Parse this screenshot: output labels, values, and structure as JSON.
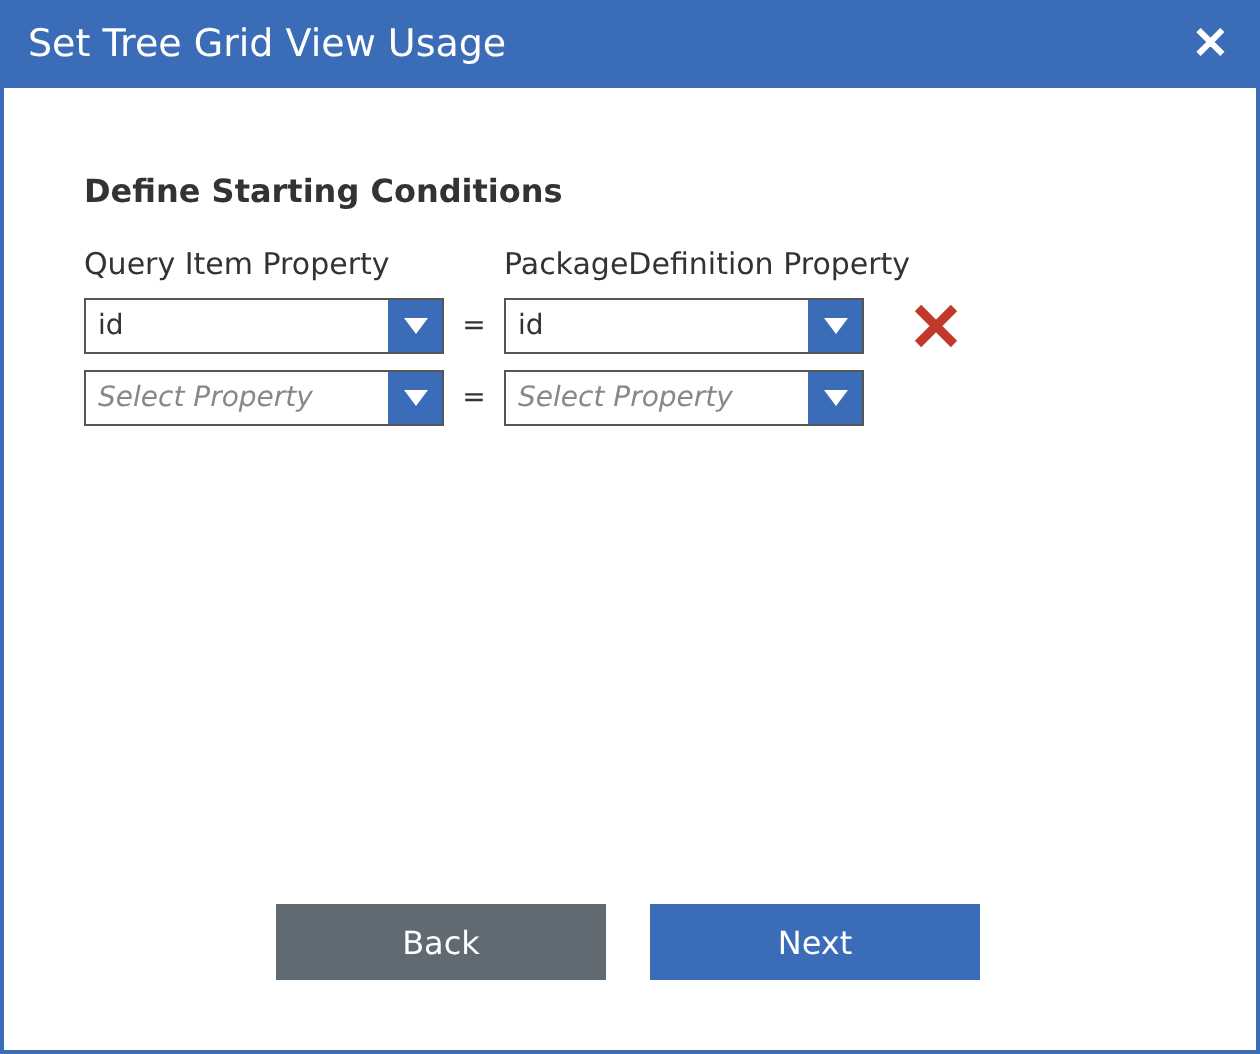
{
  "window": {
    "title": "Set Tree Grid View Usage",
    "close": "✕"
  },
  "heading": "Define Starting Conditions",
  "columns": [
    "Query Item Property",
    "PackageDefinition Property"
  ],
  "conditions": [
    {
      "left": {
        "value": "id"
      },
      "operator": "=",
      "right": {
        "value": "id"
      },
      "removable": true
    },
    {
      "left": {
        "placeholder": "Select Property"
      },
      "operator": "=",
      "right": {
        "placeholder": "Select Property"
      },
      "removable": false
    }
  ],
  "buttons": [
    {
      "label": "Back",
      "kind": "secondary"
    },
    {
      "label": "Next",
      "kind": "primary"
    }
  ]
}
